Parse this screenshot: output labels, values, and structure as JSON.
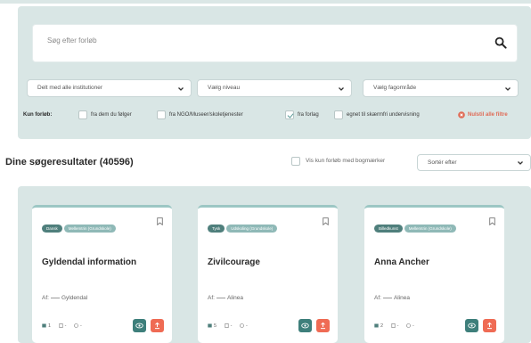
{
  "search": {
    "placeholder": "Søg efter forløb"
  },
  "filters": {
    "institution": "Delt med alle institutioner",
    "level": "Vælg niveau",
    "subject": "Vælg fagområde"
  },
  "only_courses": {
    "label": "Kun forløb:",
    "options": [
      {
        "label": "fra dem du følger",
        "checked": false
      },
      {
        "label": "fra NGO/Museer/skoletjenester",
        "checked": false
      },
      {
        "label": "fra forlag",
        "checked": true
      },
      {
        "label": "egnet til skærmfri undervisning",
        "checked": false
      }
    ],
    "reset_label": "Nulstil alle filtre"
  },
  "results": {
    "title": "Dine søgeresultater (40596)",
    "bookmark_only_label": "Vis kun forløb med bogmærker",
    "sort_label": "Sortér efter"
  },
  "cards": [
    {
      "tags": [
        "Dansk",
        "Mellemtrin (Grundskole)"
      ],
      "title": "Gyldendal information",
      "author_prefix": "Af:",
      "author": "Gyldendal",
      "stats": [
        "1",
        "-",
        "-"
      ]
    },
    {
      "tags": [
        "Tysk",
        "Udskoling (Grundskole)"
      ],
      "title": "Zivilcourage",
      "author_prefix": "Af:",
      "author": "Alinea",
      "stats": [
        "5",
        "-",
        "-"
      ]
    },
    {
      "tags": [
        "Billedkunst",
        "Mellemtrin (Grundskole)"
      ],
      "title": "Anna Ancher",
      "author_prefix": "Af:",
      "author": "Alinea",
      "stats": [
        "2",
        "-",
        "-"
      ]
    }
  ],
  "colors": {
    "panel_bg": "#d9e6e5",
    "primary_tag": "#4f7f7c",
    "secondary_tag": "#8fb9b7",
    "view_button": "#3e7f7b",
    "add_button": "#ef6b54",
    "reset": "#e06a55"
  },
  "icons": {
    "search": "search-icon",
    "chevron": "chevron-down-icon",
    "bookmark": "bookmark-icon",
    "view": "eye-icon",
    "add": "upload-icon",
    "reset": "close-circle-icon"
  }
}
